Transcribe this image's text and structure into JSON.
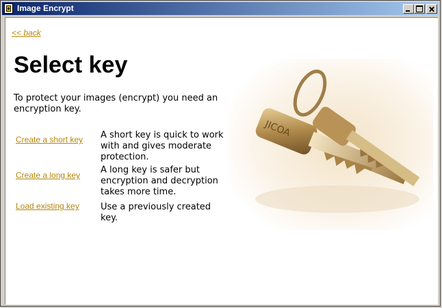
{
  "window": {
    "title": "Image Encrypt"
  },
  "nav": {
    "back": "<< back"
  },
  "page": {
    "title": "Select key",
    "intro": "To protect your images (encrypt) you need an encryption key."
  },
  "options": [
    {
      "link": "Create a short key",
      "desc": "A short key is quick to work with and gives moderate protection."
    },
    {
      "link": "Create a long key",
      "desc": "A long key is safer but encryption and decryption takes more time."
    },
    {
      "link": "Load existing key",
      "desc": "Use a previously created key."
    }
  ],
  "colors": {
    "link": "#b8860b",
    "titlebar_start": "#0a246a",
    "titlebar_end": "#a6caf0"
  }
}
